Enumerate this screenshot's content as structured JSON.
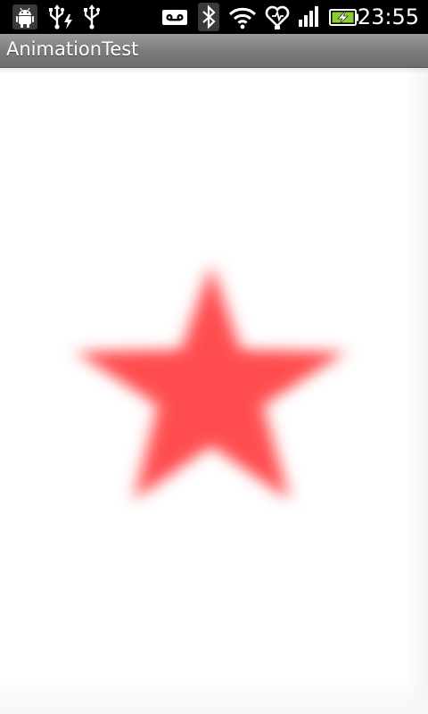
{
  "status_bar": {
    "time": "23:55",
    "icons": [
      "android-debug-icon",
      "usb-charging-icon",
      "usb-icon",
      "voicemail-icon",
      "bluetooth-icon",
      "wifi-icon",
      "heart-sync-icon",
      "signal-icon",
      "battery-charging-icon"
    ]
  },
  "title_bar": {
    "title": "AnimationTest"
  },
  "content": {
    "star": {
      "shape": "star-icon",
      "color": "#ff4d4f"
    }
  },
  "colors": {
    "status_bar": "#000000",
    "title_bar": "#7a7a7a",
    "background": "#ffffff",
    "star": "#ff4d4f"
  }
}
